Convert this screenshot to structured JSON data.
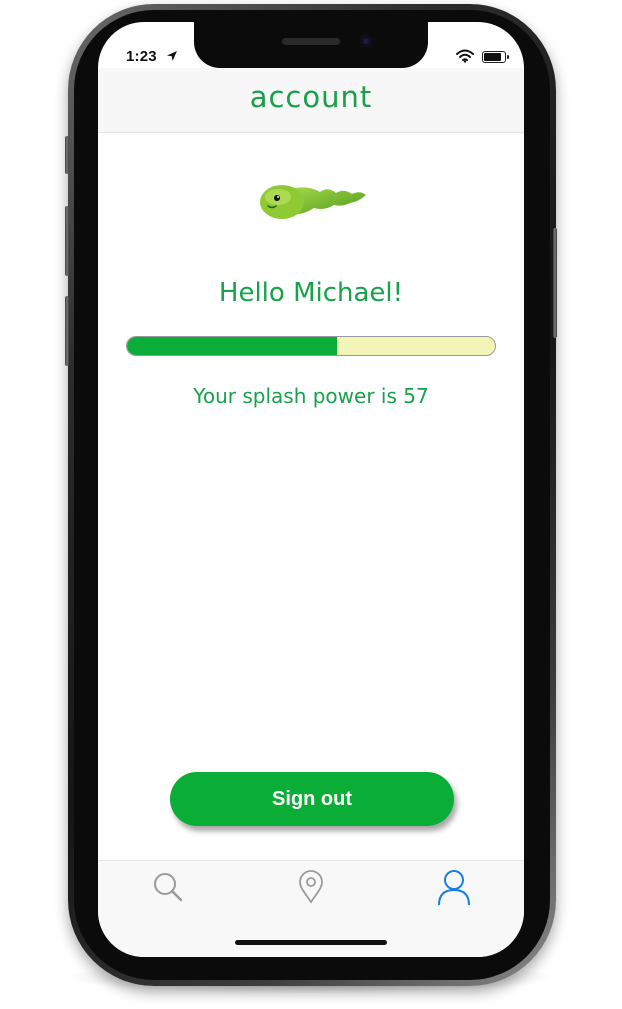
{
  "status_bar": {
    "time": "1:23",
    "battery_level": 0.85
  },
  "header": {
    "title": "account"
  },
  "profile": {
    "greeting": "Hello Michael!",
    "power_text": "Your splash power is 57",
    "power_value": 57,
    "power_fraction": 0.57
  },
  "actions": {
    "sign_out_label": "Sign out"
  },
  "tab_bar": {
    "tabs": [
      {
        "icon": "search-icon",
        "active": false
      },
      {
        "icon": "location-pin-icon",
        "active": false
      },
      {
        "icon": "user-icon",
        "active": true
      }
    ]
  },
  "colors": {
    "brand_green": "#16a34a",
    "button_green": "#0aad36",
    "progress_track": "#f3f4b7",
    "active_tab": "#1a7fe0",
    "inactive_tab": "#9a9a9a"
  }
}
